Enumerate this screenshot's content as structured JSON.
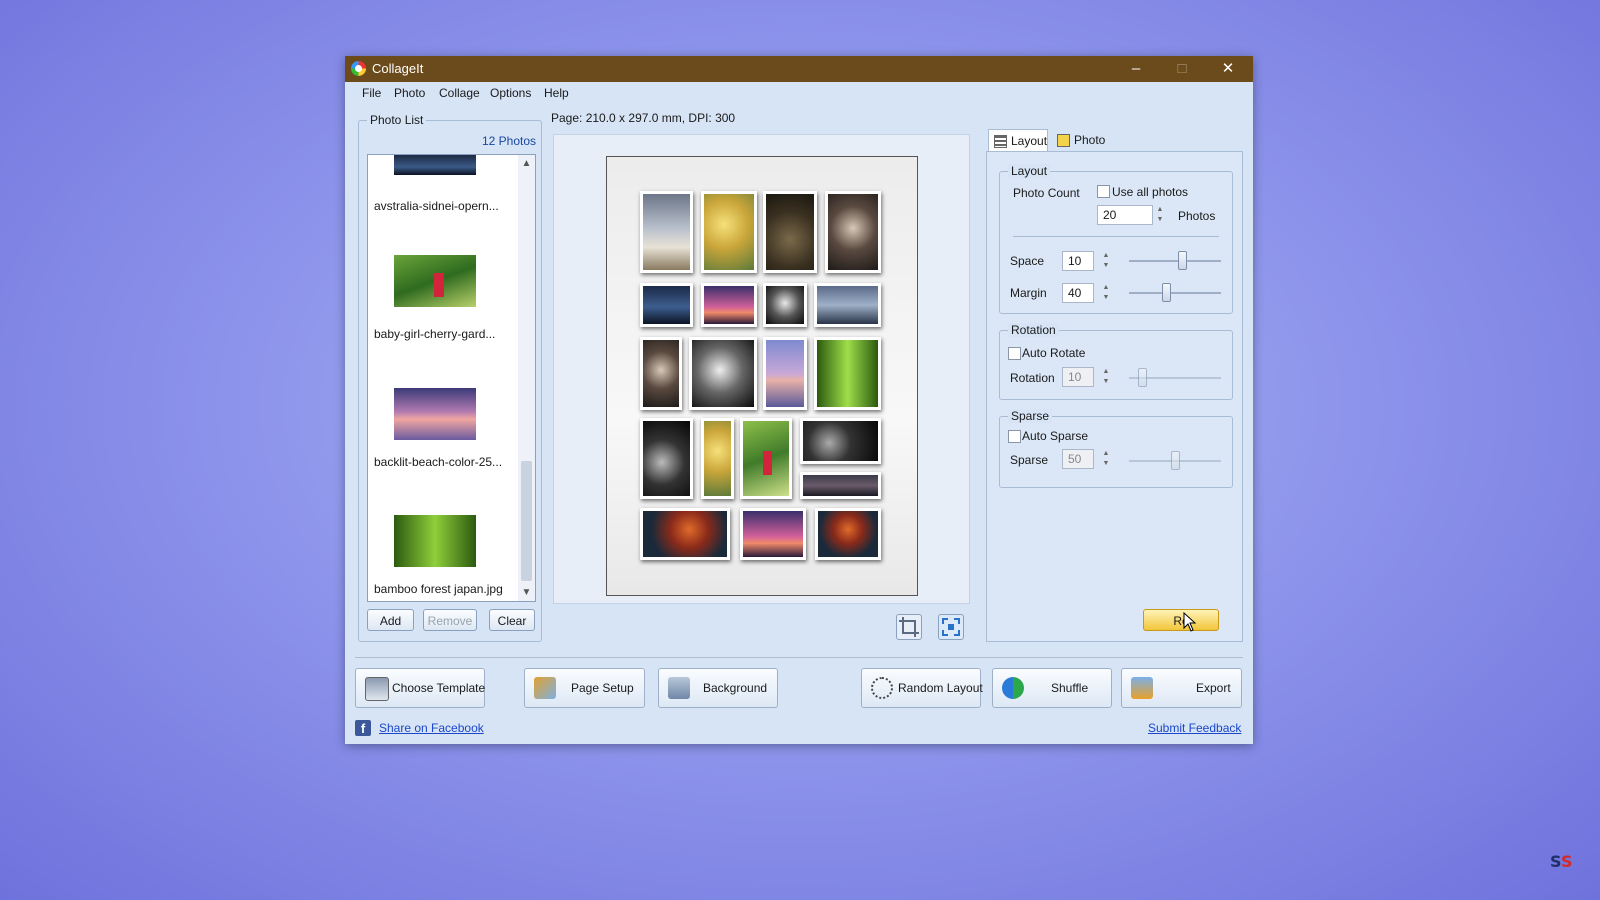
{
  "window": {
    "title": "CollageIt",
    "minimize": "–",
    "maximize": "□",
    "close": "✕"
  },
  "menu": [
    "File",
    "Photo",
    "Collage",
    "Options",
    "Help"
  ],
  "photo_list": {
    "group_title": "Photo List",
    "count": "12 Photos",
    "items": [
      {
        "label": "avstralia-sidnei-opern...",
        "icon": "photo-thumbnail"
      },
      {
        "label": "baby-girl-cherry-gard...",
        "icon": "photo-thumbnail"
      },
      {
        "label": "backlit-beach-color-25...",
        "icon": "photo-thumbnail"
      },
      {
        "label": "bamboo forest japan.jpg",
        "icon": "photo-thumbnail"
      }
    ],
    "buttons": {
      "add": "Add",
      "remove": "Remove",
      "clear": "Clear"
    }
  },
  "page_info": "Page: 210.0 x 297.0 mm, DPI: 300",
  "tabs": {
    "layout": "Layout",
    "photo": "Photo"
  },
  "layout_panel": {
    "layout_group": "Layout",
    "photo_count_label": "Photo Count",
    "use_all_photos": "Use all photos",
    "photo_count_value": "20",
    "photos_suffix": "Photos",
    "space_label": "Space",
    "space_value": "10",
    "margin_label": "Margin",
    "margin_value": "40",
    "rotation_group": "Rotation",
    "auto_rotate": "Auto Rotate",
    "rotation_label": "Rotation",
    "rotation_value": "10",
    "sparse_group": "Sparse",
    "auto_sparse": "Auto Sparse",
    "sparse_label": "Sparse",
    "sparse_value": "50",
    "reset_button": "Re"
  },
  "bottom_buttons": {
    "choose_template": "Choose Template",
    "page_setup": "Page Setup",
    "background": "Background",
    "random_layout": "Random Layout",
    "shuffle": "Shuffle",
    "export": "Export"
  },
  "links": {
    "share": "Share on Facebook",
    "feedback": "Submit Feedback"
  },
  "colors": {
    "titlebar": "#6b4b1c",
    "window_bg": "#d6e4f5",
    "link": "#1b47c9",
    "reset_button": "#f7d04a"
  }
}
